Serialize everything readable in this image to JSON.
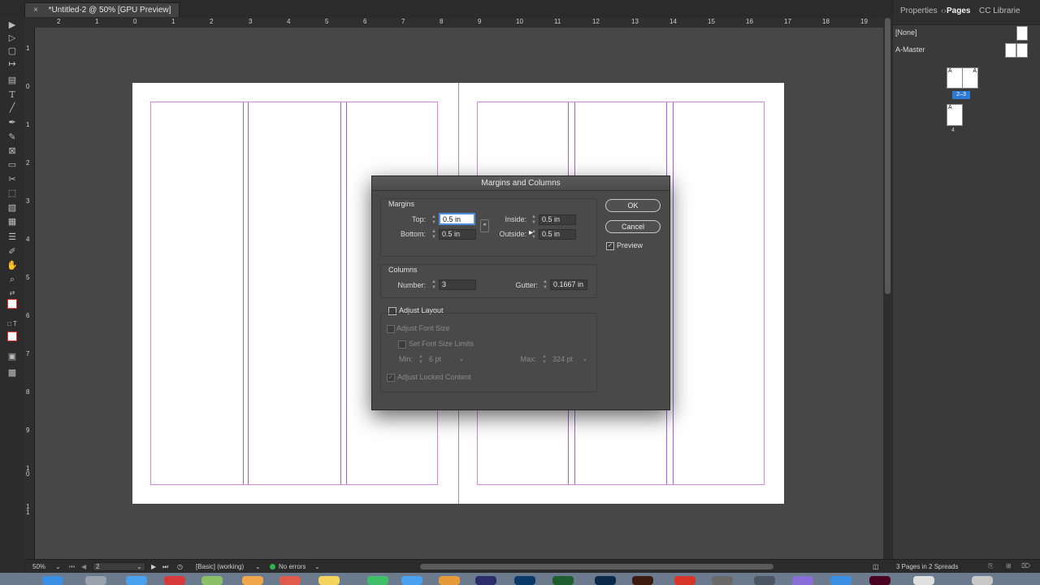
{
  "document_tab": {
    "close": "×",
    "title": "*Untitled-2 @ 50% [GPU Preview]"
  },
  "panel": {
    "tabs": [
      "Properties",
      "Pages",
      "CC Librarie"
    ],
    "rows": [
      "[None]",
      "A-Master"
    ],
    "spread_label": "2–3",
    "page_label": "4",
    "master_letter": "A",
    "status": "3 Pages in 2 Spreads"
  },
  "ruler": {
    "h": [
      "2",
      "1",
      "0",
      "1",
      "2",
      "3",
      "4",
      "5",
      "6",
      "7",
      "8",
      "9",
      "10",
      "11",
      "12",
      "13",
      "14",
      "15",
      "16",
      "17",
      "18",
      "19"
    ],
    "v": [
      "1",
      "0",
      "1",
      "2",
      "3",
      "4",
      "5",
      "6",
      "7",
      "8",
      "9",
      "1\n0",
      "1\n1"
    ]
  },
  "status_bar": {
    "zoom": "50%",
    "page": "2",
    "profile": "[Basic] (working)",
    "preflight": "No errors"
  },
  "dialog": {
    "title": "Margins and Columns",
    "margins_label": "Margins",
    "top_label": "Top:",
    "top_value": "0.5 in",
    "bottom_label": "Bottom:",
    "bottom_value": "0.5 in",
    "inside_label": "Inside:",
    "inside_value": "0.5 in",
    "outside_label": "Outside:",
    "outside_value": "0.5 in",
    "columns_label": "Columns",
    "number_label": "Number:",
    "number_value": "3",
    "gutter_label": "Gutter:",
    "gutter_value": "0.1667 in",
    "adjust_layout_label": "Adjust Layout",
    "adjust_font_size_label": "Adjust Font Size",
    "set_font_limits_label": "Set Font Size Limits",
    "min_label": "Min:",
    "min_value": "6 pt",
    "max_label": "Max:",
    "max_value": "324 pt",
    "adjust_locked_label": "Adjust Locked Content",
    "ok_label": "OK",
    "cancel_label": "Cancel",
    "preview_label": "Preview",
    "check": "✓"
  },
  "colors": {
    "margin_guide": "#d685e0",
    "column_guide": "#9c63d8",
    "accent": "#4a8fe0"
  }
}
